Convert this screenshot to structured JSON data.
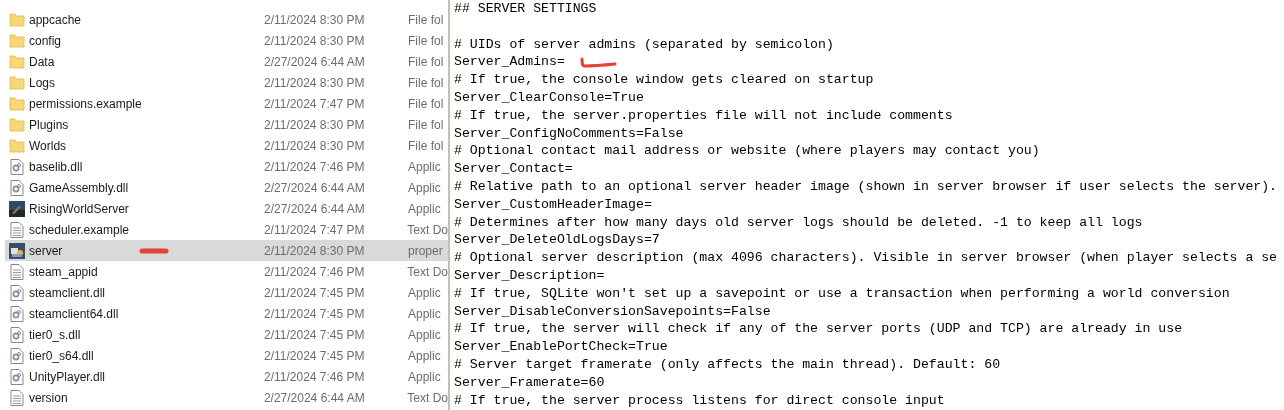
{
  "explorer": {
    "files": [
      {
        "name": "appcache",
        "date": "2/11/2024 8:30 PM",
        "type": "File fol",
        "kind": "folder",
        "selected": false
      },
      {
        "name": "config",
        "date": "2/11/2024 8:30 PM",
        "type": "File fol",
        "kind": "folder",
        "selected": false
      },
      {
        "name": "Data",
        "date": "2/27/2024 6:44 AM",
        "type": "File fol",
        "kind": "folder",
        "selected": false
      },
      {
        "name": "Logs",
        "date": "2/11/2024 8:30 PM",
        "type": "File fol",
        "kind": "folder",
        "selected": false
      },
      {
        "name": "permissions.example",
        "date": "2/11/2024 7:47 PM",
        "type": "File fol",
        "kind": "folder",
        "selected": false
      },
      {
        "name": "Plugins",
        "date": "2/11/2024 8:30 PM",
        "type": "File fol",
        "kind": "folder",
        "selected": false
      },
      {
        "name": "Worlds",
        "date": "2/11/2024 8:30 PM",
        "type": "File fol",
        "kind": "folder",
        "selected": false
      },
      {
        "name": "baselib.dll",
        "date": "2/11/2024 7:46 PM",
        "type": "Applic",
        "kind": "dll",
        "selected": false
      },
      {
        "name": "GameAssembly.dll",
        "date": "2/27/2024 6:44 AM",
        "type": "Applic",
        "kind": "dll",
        "selected": false
      },
      {
        "name": "RisingWorldServer",
        "date": "2/27/2024 6:44 AM",
        "type": "Applic",
        "kind": "app",
        "selected": false
      },
      {
        "name": "scheduler.example",
        "date": "2/11/2024 7:47 PM",
        "type": "Text Do",
        "kind": "text",
        "selected": false
      },
      {
        "name": "server",
        "date": "2/11/2024 8:30 PM",
        "type": "proper",
        "kind": "config",
        "selected": true
      },
      {
        "name": "steam_appid",
        "date": "2/11/2024 7:46 PM",
        "type": "Text Do",
        "kind": "text",
        "selected": false
      },
      {
        "name": "steamclient.dll",
        "date": "2/11/2024 7:45 PM",
        "type": "Applic",
        "kind": "dll",
        "selected": false
      },
      {
        "name": "steamclient64.dll",
        "date": "2/11/2024 7:45 PM",
        "type": "Applic",
        "kind": "dll",
        "selected": false
      },
      {
        "name": "tier0_s.dll",
        "date": "2/11/2024 7:45 PM",
        "type": "Applic",
        "kind": "dll",
        "selected": false
      },
      {
        "name": "tier0_s64.dll",
        "date": "2/11/2024 7:45 PM",
        "type": "Applic",
        "kind": "dll",
        "selected": false
      },
      {
        "name": "UnityPlayer.dll",
        "date": "2/11/2024 7:46 PM",
        "type": "Applic",
        "kind": "dll",
        "selected": false
      },
      {
        "name": "version",
        "date": "2/27/2024 6:44 AM",
        "type": "Text Do",
        "kind": "text",
        "selected": false
      }
    ]
  },
  "editor": {
    "lines": [
      "## SERVER SETTINGS",
      "# UIDs of server admins (separated by semicolon)",
      "Server_Admins=",
      "# If true, the console window gets cleared on startup",
      "Server_ClearConsole=True",
      "# If true, the server.properties file will not include comments",
      "Server_ConfigNoComments=False",
      "# Optional contact mail address or website (where players may contact you)",
      "Server_Contact=",
      "# Relative path to an optional server header image (shown in server browser if user selects the server).",
      "Server_CustomHeaderImage=",
      "# Determines after how many days old server logs should be deleted. -1 to keep all logs",
      "Server_DeleteOldLogsDays=7",
      "# Optional server description (max 4096 characters). Visible in server browser (when player selects a se",
      "Server_Description=",
      "# If true, SQLite won't set up a savepoint or use a transaction when performing a world conversion",
      "Server_DisableConversionSavepoints=False",
      "# If true, the server will check if any of the server ports (UDP and TCP) are already in use",
      "Server_EnablePortCheck=True",
      "# Server target framerate (only affects the main thread). Default: 60",
      "Server_Framerate=60",
      "# If true, the server process listens for direct console input"
    ]
  }
}
